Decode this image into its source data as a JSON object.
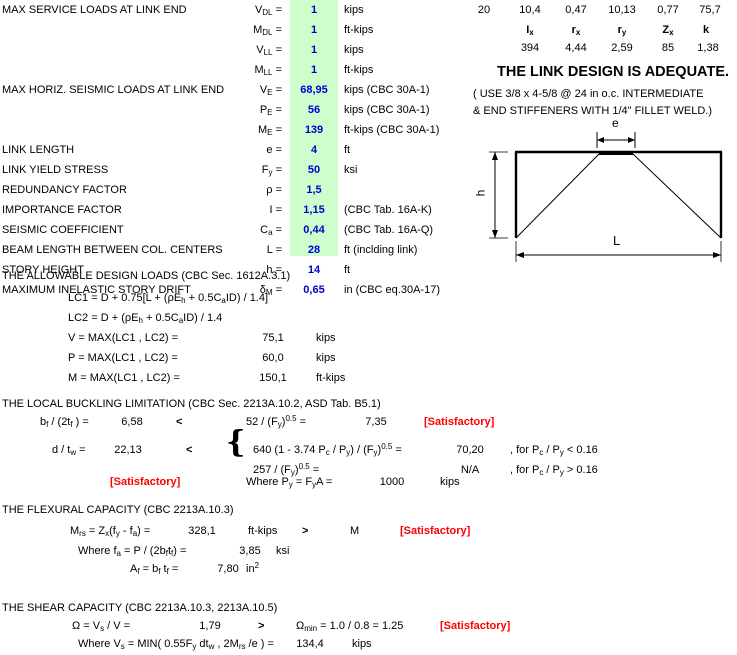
{
  "section_loads": {
    "rows": [
      {
        "label": "MAX SERVICE LOADS AT LINK END",
        "sym": "V",
        "sub": "DL",
        "val": "1",
        "unit": "kips"
      },
      {
        "label": "",
        "sym": "M",
        "sub": "DL",
        "val": "1",
        "unit": "ft-kips"
      },
      {
        "label": "",
        "sym": "V",
        "sub": "LL",
        "val": "1",
        "unit": "kips"
      },
      {
        "label": "",
        "sym": "M",
        "sub": "LL",
        "val": "1",
        "unit": "ft-kips"
      },
      {
        "label": "MAX HORIZ. SEISMIC LOADS AT LINK END",
        "sym": "V",
        "sub": "E",
        "val": "68,95",
        "unit": "kips (CBC 30A-1)"
      },
      {
        "label": "",
        "sym": "P",
        "sub": "E",
        "val": "56",
        "unit": "kips (CBC 30A-1)"
      },
      {
        "label": "",
        "sym": "M",
        "sub": "E",
        "val": "139",
        "unit": "ft-kips (CBC 30A-1)"
      },
      {
        "label": "LINK LENGTH",
        "sym": "e",
        "sub": "",
        "val": "4",
        "unit": "ft"
      },
      {
        "label": "LINK YIELD STRESS",
        "sym": "F",
        "sub": "y",
        "val": "50",
        "unit": "ksi"
      },
      {
        "label": "REDUNDANCY FACTOR",
        "sym": "ρ",
        "sub": "",
        "val": "1,5",
        "unit": ""
      },
      {
        "label": "IMPORTANCE FACTOR",
        "sym": "I",
        "sub": "",
        "val": "1,15",
        "unit": "(CBC Tab. 16A-K)"
      },
      {
        "label": "SEISMIC COEFFICIENT",
        "sym": "C",
        "sub": "a",
        "val": "0,44",
        "unit": "(CBC Tab. 16A-Q)"
      },
      {
        "label": "BEAM LENGTH BETWEEN COL. CENTERS",
        "sym": "L",
        "sub": "",
        "val": "28",
        "unit": "ft (inclding link)"
      },
      {
        "label": "STORY HEIGHT",
        "sym": "h",
        "sub": "",
        "val": "14",
        "unit": "ft"
      },
      {
        "label": "MAXIMUM INELASTIC STORY DRIFT",
        "sym": "δ",
        "sub": "M",
        "val": "0,65",
        "unit": "in (CBC eq.30A-17)"
      }
    ]
  },
  "section_props": {
    "top_row_values": [
      "20",
      "10,4",
      "0,47",
      "10,13",
      "0,77",
      "75,7"
    ],
    "headers": [
      "I",
      "r",
      "r",
      "Z",
      "k"
    ],
    "header_subs": [
      "x",
      "x",
      "y",
      "x",
      ""
    ],
    "values": [
      "394",
      "4,44",
      "2,59",
      "85",
      "1,38"
    ]
  },
  "verdict": {
    "title": "THE LINK DESIGN IS ADEQUATE.",
    "note_line1": "( USE 3/8 x 4-5/8 @ 24 in o.c. INTERMEDIATE",
    "note_line2": "& END STIFFENERS WITH 1/4\" FILLET WELD.)"
  },
  "diagram": {
    "label_e": "e",
    "label_h": "h",
    "label_L": "L"
  },
  "allowable": {
    "heading": "THE ALLOWABLE DESIGN LOADS (CBC Sec. 1612A.3.1)",
    "lc1": "LC1 = D + 0.75[L + (ρE",
    "lc1_sub": "h",
    "lc1_tail": " + 0.5C",
    "lc1_sub2": "a",
    "lc1_tail2": "ID) / 1.4]",
    "lc2": "LC2 = D + (ρE",
    "lc2_sub": "h",
    "lc2_tail": " + 0.5C",
    "lc2_sub2": "a",
    "lc2_tail2": "ID) / 1.4",
    "rows": [
      {
        "expr": "V = MAX(LC1 , LC2)  =",
        "val": "75,1",
        "unit": "kips"
      },
      {
        "expr": "P = MAX(LC1 , LC2)  =",
        "val": "60,0",
        "unit": "kips"
      },
      {
        "expr": "M = MAX(LC1 , LC2)  =",
        "val": "150,1",
        "unit": "ft-kips"
      }
    ]
  },
  "buckling": {
    "heading": "THE LOCAL BUCKLING LIMITATION (CBC Sec. 2213A.10.2, ASD Tab. B5.1)",
    "r1_left": "b",
    "r1_left_sub": "f",
    "r1_left_tail": " / (2t",
    "r1_left_sub2": "f",
    "r1_left_tail2": " ) =",
    "r1_val": "6,58",
    "r1_op": "<",
    "r1_right": "52 / (F",
    "r1_right_sub": "y",
    "r1_right_tail": ")",
    "r1_right_sup": "0.5",
    "r1_right_tail2": " =",
    "r1_rval": "7,35",
    "r1_status": "[Satisfactory]",
    "r2_left": "d / t",
    "r2_left_sub": "w",
    "r2_left_tail": " =",
    "r2_val": "22,13",
    "r2_op": "<",
    "r2_right1": "640 (1 - 3.74 P",
    "r2_right1_sub": "c",
    "r2_right1_mid": " / P",
    "r2_right1_sub2": "y",
    "r2_right1_tail": ") / (F",
    "r2_right1_sub3": "y",
    "r2_right1_tail2": ")",
    "r2_right1_sup": "0.5",
    "r2_right1_tail3": " =",
    "r2_rval1": "70,20",
    "r2_cond1": ", for P",
    "r2_cond1_sub": "c",
    "r2_cond1_mid": " / P",
    "r2_cond1_sub2": "y",
    "r2_cond1_tail": " < 0.16",
    "r2_right2": "257 / (F",
    "r2_right2_sub": "y",
    "r2_right2_tail": ")",
    "r2_right2_sup": "0.5",
    "r2_right2_tail2": " =",
    "r2_rval2": "N/A",
    "r2_cond2": ", for P",
    "r2_cond2_sub": "c",
    "r2_cond2_mid": " / P",
    "r2_cond2_sub2": "y",
    "r2_cond2_tail": " > 0.16",
    "r3_status": "[Satisfactory]",
    "r3_where": "Where   P",
    "r3_where_sub": "y",
    "r3_where_mid": " = F",
    "r3_where_sub2": "y",
    "r3_where_tail": "A  =",
    "r3_val": "1000",
    "r3_unit": "kips"
  },
  "flexural": {
    "heading": "THE FLEXURAL CAPACITY (CBC 2213A.10.3)",
    "r1_expr": "M",
    "r1_sub": "rs",
    "r1_mid": "  = Z",
    "r1_sub2": "x",
    "r1_mid2": "(f",
    "r1_sub3": "y",
    "r1_mid3": " - f",
    "r1_sub4": "a",
    "r1_tail": ") =",
    "r1_val": "328,1",
    "r1_unit": "ft-kips",
    "r1_op": ">",
    "r1_rhs": "M",
    "r1_status": "[Satisfactory]",
    "r2_expr": "Where     f",
    "r2_sub": "a",
    "r2_mid": " = P / (2b",
    "r2_sub2": "f",
    "r2_mid2": "t",
    "r2_sub3": "f",
    "r2_tail": ") =",
    "r2_val": "3,85",
    "r2_unit": "ksi",
    "r3_expr": "A",
    "r3_sub": "f",
    "r3_mid": " = b",
    "r3_sub2": "f",
    "r3_mid2": " t",
    "r3_sub3": "f",
    "r3_tail": " =",
    "r3_val": "7,80",
    "r3_unit": "in",
    "r3_unit_sup": "2"
  },
  "shear": {
    "heading": "THE SHEAR CAPACITY (CBC 2213A.10.3, 2213A.10.5)",
    "r1_expr": "Ω = V",
    "r1_sub": "s",
    "r1_tail": " / V =",
    "r1_val": "1,79",
    "r1_op": ">",
    "r1_rhs": "Ω",
    "r1_rhs_sub": "min",
    "r1_rhs_tail": " = 1.0 / 0.8 = 1.25",
    "r1_status": "[Satisfactory]",
    "r2_expr": "Where    V",
    "r2_sub": "s",
    "r2_mid": " = MIN( 0.55F",
    "r2_sub2": "y",
    "r2_mid2": " dt",
    "r2_sub3": "w",
    "r2_mid3": " ,  2M",
    "r2_sub4": "rs",
    "r2_tail": " /e ) =",
    "r2_val": "134,4",
    "r2_unit": "kips"
  },
  "colors": {
    "value_blue": "#0000cc",
    "status_red": "#ff0000",
    "cell_green": "#ccffcc"
  }
}
